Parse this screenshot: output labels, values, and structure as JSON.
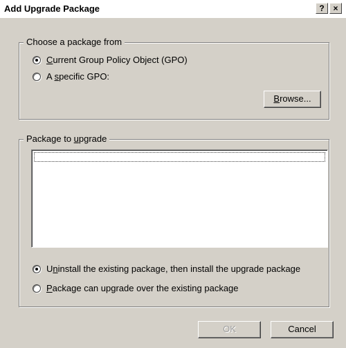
{
  "window": {
    "title": "Add Upgrade Package",
    "help_glyph": "?",
    "close_glyph": "×"
  },
  "choose_group": {
    "legend": "Choose a package from",
    "options": [
      {
        "pre": "",
        "key": "C",
        "post": "urrent Group Policy Object (GPO)",
        "checked": true
      },
      {
        "pre": "A ",
        "key": "s",
        "post": "pecific GPO:",
        "checked": false
      }
    ],
    "browse": {
      "pre": "",
      "key": "B",
      "post": "rowse..."
    }
  },
  "upgrade_group": {
    "legend": {
      "pre": "Package to ",
      "key": "u",
      "post": "pgrade"
    },
    "packages": [],
    "options": [
      {
        "pre": "U",
        "key": "n",
        "post": "install the existing package, then install the upgrade package",
        "checked": true
      },
      {
        "pre": "",
        "key": "P",
        "post": "ackage can upgrade over the existing package",
        "checked": false
      }
    ]
  },
  "footer": {
    "ok_label": "OK",
    "ok_enabled": false,
    "cancel_label": "Cancel"
  }
}
